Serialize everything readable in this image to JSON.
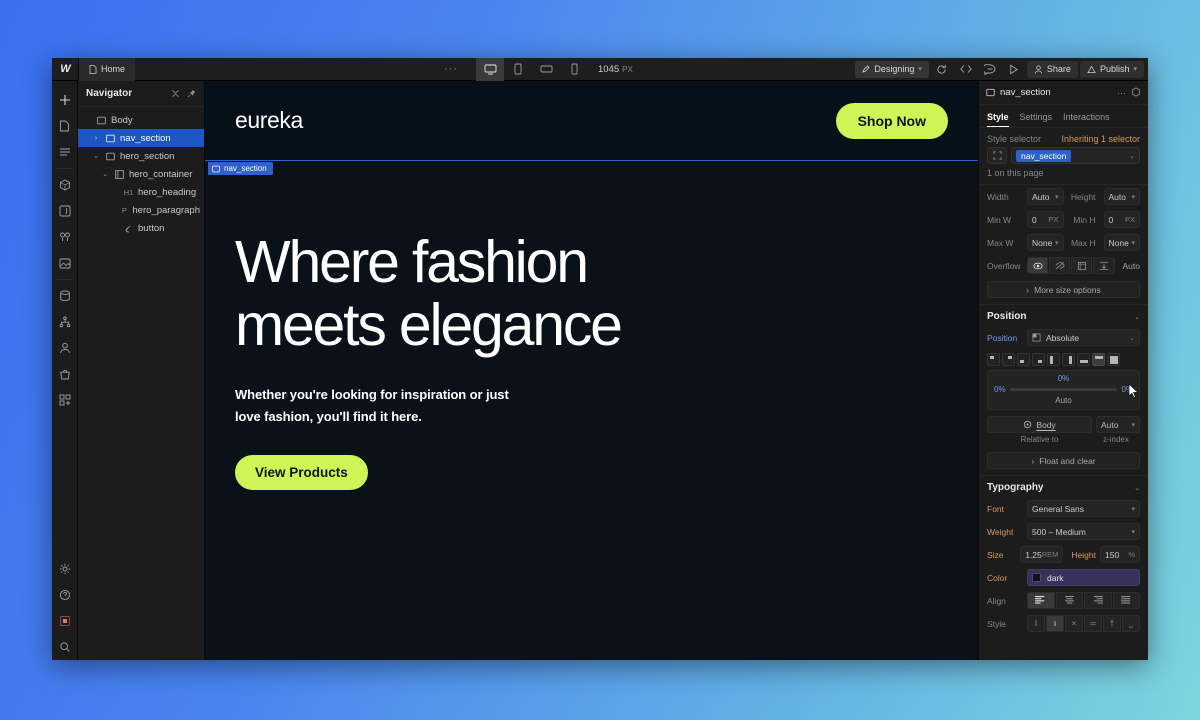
{
  "topbar": {
    "logo": "webflow-logo-icon",
    "page_label": "Home",
    "ellipsis": "···",
    "breakpoints": [
      {
        "name": "breakpoint-desktop",
        "icon": "desktop-icon",
        "active": true
      },
      {
        "name": "breakpoint-tablet",
        "icon": "tablet-icon",
        "active": false
      },
      {
        "name": "breakpoint-landscape",
        "icon": "mobile-landscape-icon",
        "active": false
      },
      {
        "name": "breakpoint-mobile",
        "icon": "mobile-portrait-icon",
        "active": false
      }
    ],
    "canvas_width": "1045",
    "canvas_width_unit": "PX",
    "mode_label": "Designing",
    "actions": [
      {
        "name": "undo-redo-icon",
        "glyph": "↻"
      },
      {
        "name": "code-icon",
        "glyph": "‹›"
      },
      {
        "name": "comment-icon",
        "glyph": "◎"
      },
      {
        "name": "preview-icon",
        "glyph": "▷"
      }
    ],
    "share_label": "Share",
    "publish_label": "Publish"
  },
  "rail": {
    "items": [
      {
        "name": "add-element-icon",
        "glyph": "+"
      },
      {
        "name": "pages-icon",
        "glyph": "❐"
      },
      {
        "name": "navigator-icon",
        "glyph": "☰"
      },
      {
        "name": "components-icon",
        "glyph": "⬡"
      },
      {
        "name": "style-manager-icon",
        "glyph": "◩"
      },
      {
        "name": "variables-icon",
        "glyph": "◌"
      },
      {
        "name": "assets-icon",
        "glyph": "⛰"
      },
      {
        "name": "cms-icon",
        "glyph": "⛁"
      },
      {
        "name": "logic-icon",
        "glyph": "⌥"
      },
      {
        "name": "users-icon",
        "glyph": "☺"
      },
      {
        "name": "ecommerce-icon",
        "glyph": "⛃"
      },
      {
        "name": "apps-icon",
        "glyph": "⌗"
      },
      {
        "name": "settings-icon",
        "glyph": "⚙"
      },
      {
        "name": "help-icon",
        "glyph": "?"
      },
      {
        "name": "audit-icon",
        "glyph": "■"
      },
      {
        "name": "search-icon",
        "glyph": "⌕"
      }
    ]
  },
  "navigator": {
    "title": "Navigator",
    "collapse_icon": "collapse-all-icon",
    "pin_icon": "pin-icon",
    "tree": [
      {
        "label": "Body",
        "tag": "",
        "icon": "box-icon",
        "depth": 0,
        "twisty": "",
        "selected": false
      },
      {
        "label": "nav_section",
        "tag": "",
        "icon": "section-icon",
        "depth": 1,
        "twisty": "›",
        "selected": true
      },
      {
        "label": "hero_section",
        "tag": "",
        "icon": "section-icon",
        "depth": 1,
        "twisty": "⌄",
        "selected": false
      },
      {
        "label": "hero_container",
        "tag": "",
        "icon": "container-icon",
        "depth": 2,
        "twisty": "⌄",
        "selected": false
      },
      {
        "label": "hero_heading",
        "tag": "H1",
        "icon": "",
        "depth": 3,
        "twisty": "",
        "selected": false
      },
      {
        "label": "hero_paragraph",
        "tag": "P",
        "icon": "",
        "depth": 3,
        "twisty": "",
        "selected": false
      },
      {
        "label": "button",
        "tag": "",
        "icon": "link-block-icon",
        "depth": 3,
        "twisty": "",
        "selected": false
      }
    ]
  },
  "canvas": {
    "brand": "eureka",
    "nav_cta": "Shop Now",
    "selection_badge": "nav_section",
    "selection_badge_icon": "section-icon",
    "hero_heading": "Where fashion\nmeets elegance",
    "hero_paragraph": "Whether you're looking for inspiration or just\nlove fashion, you'll find it here.",
    "hero_cta": "View Products",
    "colors": {
      "background": "#0a1119",
      "nav_background": "#061018",
      "accent": "#cdf556",
      "selection_blue": "#2d63c8"
    }
  },
  "inspector": {
    "element_name": "nav_section",
    "element_icon": "section-icon",
    "more_icon": "···",
    "component_icon": "component-icon",
    "tabs": [
      {
        "label": "Style",
        "active": true
      },
      {
        "label": "Settings",
        "active": false
      },
      {
        "label": "Interactions",
        "active": false
      }
    ],
    "style_selector": {
      "label": "Style selector",
      "inheriting": "Inheriting 1 selector",
      "class_icon": "element-icon",
      "class_name": "nav_section",
      "chevron": "⌄",
      "usage": "1 on this page"
    },
    "size": {
      "width_label": "Width",
      "width_value": "Auto",
      "height_label": "Height",
      "height_value": "Auto",
      "minw_label": "Min W",
      "minw_value": "0",
      "minw_unit": "PX",
      "minh_label": "Min H",
      "minh_value": "0",
      "minh_unit": "PX",
      "maxw_label": "Max W",
      "maxw_value": "None",
      "maxh_label": "Max H",
      "maxh_value": "None",
      "overflow_label": "Overflow",
      "overflow_options": [
        {
          "name": "overflow-visible-icon",
          "glyph": "◉",
          "active": true
        },
        {
          "name": "overflow-hidden-icon",
          "glyph": "⊘",
          "active": false
        },
        {
          "name": "overflow-scroll-icon",
          "glyph": "⧉",
          "active": false
        },
        {
          "name": "overflow-auto-icon",
          "glyph": "↧",
          "active": false
        }
      ],
      "overflow_auto_label": "Auto",
      "more_size_options": "More size options",
      "more_chevron": "›"
    },
    "position": {
      "section_title": "Position",
      "section_chevron": "⌄",
      "label": "Position",
      "value": "Absolute",
      "value_icon": "position-absolute-icon",
      "chevron": "⌄",
      "anchors": [
        {
          "name": "anchor-top-left",
          "selected": false
        },
        {
          "name": "anchor-top-right",
          "selected": false
        },
        {
          "name": "anchor-bottom-left",
          "selected": false
        },
        {
          "name": "anchor-bottom-right",
          "selected": false
        },
        {
          "name": "anchor-left-full",
          "selected": false
        },
        {
          "name": "anchor-right-full",
          "selected": false
        },
        {
          "name": "anchor-bottom-full",
          "selected": false
        },
        {
          "name": "anchor-top-full",
          "selected": true
        },
        {
          "name": "anchor-full",
          "selected": false
        }
      ],
      "offset_top": "0%",
      "offset_left": "0%",
      "offset_right": "0%",
      "offset_bottom": "Auto",
      "relative_value": "Body",
      "relative_icon": "target-icon",
      "zindex_value": "Auto",
      "relative_caption": "Relative to",
      "zindex_caption": "z-index",
      "float_and_clear": "Float and clear",
      "float_chevron": "›"
    },
    "typography": {
      "section_title": "Typography",
      "section_chevron": "⌄",
      "font_label": "Font",
      "font_value": "General Sans",
      "weight_label": "Weight",
      "weight_value": "500 – Medium",
      "size_label": "Size",
      "size_value": "1.25",
      "size_unit": "REM",
      "height_label": "Height",
      "height_value": "150",
      "height_unit": "%",
      "color_label": "Color",
      "color_value": "dark",
      "color_swatch": "#0d1220",
      "align_label": "Align",
      "align_options": [
        {
          "name": "align-left-icon",
          "active": true
        },
        {
          "name": "align-center-icon",
          "active": false
        },
        {
          "name": "align-right-icon",
          "active": false
        },
        {
          "name": "align-justify-icon",
          "active": false
        }
      ],
      "style_label": "Style",
      "style_options": [
        {
          "name": "italic-icon",
          "glyph": "I",
          "active": false
        },
        {
          "name": "oblique-icon",
          "glyph": "ı",
          "active": true
        },
        {
          "name": "uppercase-icon",
          "glyph": "×",
          "active": false
        },
        {
          "name": "underline-icon",
          "glyph": "═",
          "active": false
        },
        {
          "name": "strikethrough-icon",
          "glyph": "†",
          "active": false
        },
        {
          "name": "subscript-icon",
          "glyph": "⎵",
          "active": false
        }
      ]
    }
  }
}
